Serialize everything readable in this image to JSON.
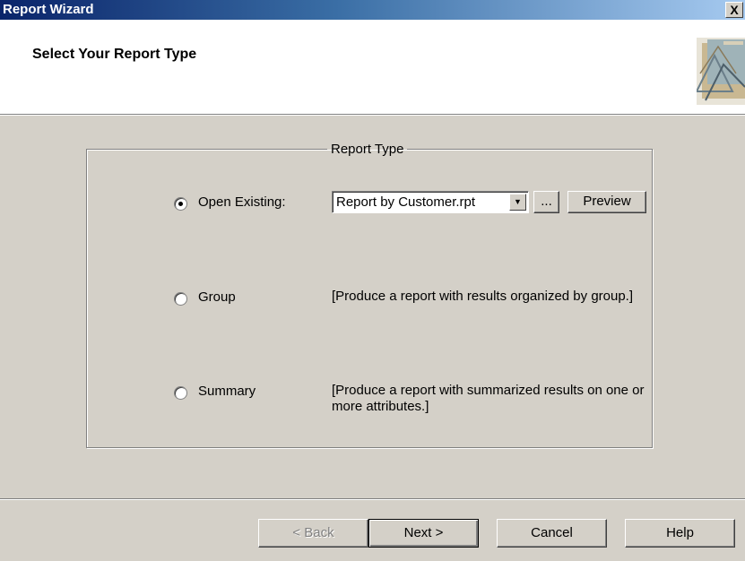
{
  "window": {
    "title": "Report Wizard",
    "close_label": "X"
  },
  "header": {
    "heading": "Select Your Report Type",
    "logo_icon": "report-wizard-logo-icon"
  },
  "report_type": {
    "legend": "Report Type",
    "options": [
      {
        "label": "Open Existing:",
        "selected": true
      },
      {
        "label": "Group",
        "selected": false,
        "description": "[Produce  a report with results organized by group.]"
      },
      {
        "label": "Summary",
        "selected": false,
        "description": "[Produce  a report with summarized results on one or more attributes.]"
      }
    ],
    "existing_report": "Report by Customer.rpt",
    "browse_label": "...",
    "preview_label": "Preview"
  },
  "footer": {
    "back_label": "< Back",
    "next_label": "Next >",
    "cancel_label": "Cancel",
    "help_label": "Help"
  }
}
